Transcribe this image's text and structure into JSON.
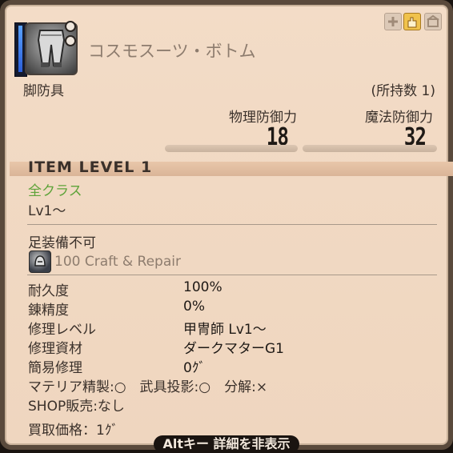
{
  "item": {
    "name": "コスモスーツ・ボトム",
    "category": "脚防具",
    "owned": "(所持数 1)",
    "item_level": "ITEM LEVEL 1",
    "classes": "全クラス",
    "level_req": "Lv1～"
  },
  "stats": {
    "phys_label": "物理防御力",
    "phys_value": "18",
    "mag_label": "魔法防御力",
    "mag_value": "32"
  },
  "equip": {
    "restriction": "足装備不可",
    "repair_tag": "100 Craft & Repair"
  },
  "details": [
    {
      "label": "耐久度",
      "value": "100%"
    },
    {
      "label": "錬精度",
      "value": "0%"
    },
    {
      "label": "修理レベル",
      "value": "甲冑師 Lv1～"
    },
    {
      "label": "修理資材",
      "value": "ダークマターG1"
    },
    {
      "label": "簡易修理",
      "value": "0ｸﾞ"
    }
  ],
  "flags": {
    "materia_line": "マテリア精製:○　武具投影:○　分解:×",
    "shop_line": "SHOP販売:なし",
    "sell_price": "買取価格：1ｸﾞ"
  },
  "footer": {
    "toggle_hint": "Altキー 詳細を非表示"
  },
  "colors": {
    "background": "#f1d9c3",
    "accent_green": "#5fa33a",
    "frame": "#5a4a3c",
    "slot_blue": "#3b74e8"
  },
  "icons": {
    "item": "pants-icon",
    "craft": "helmet-icon",
    "top": [
      "plus-icon",
      "hand-icon",
      "housing-icon"
    ]
  }
}
